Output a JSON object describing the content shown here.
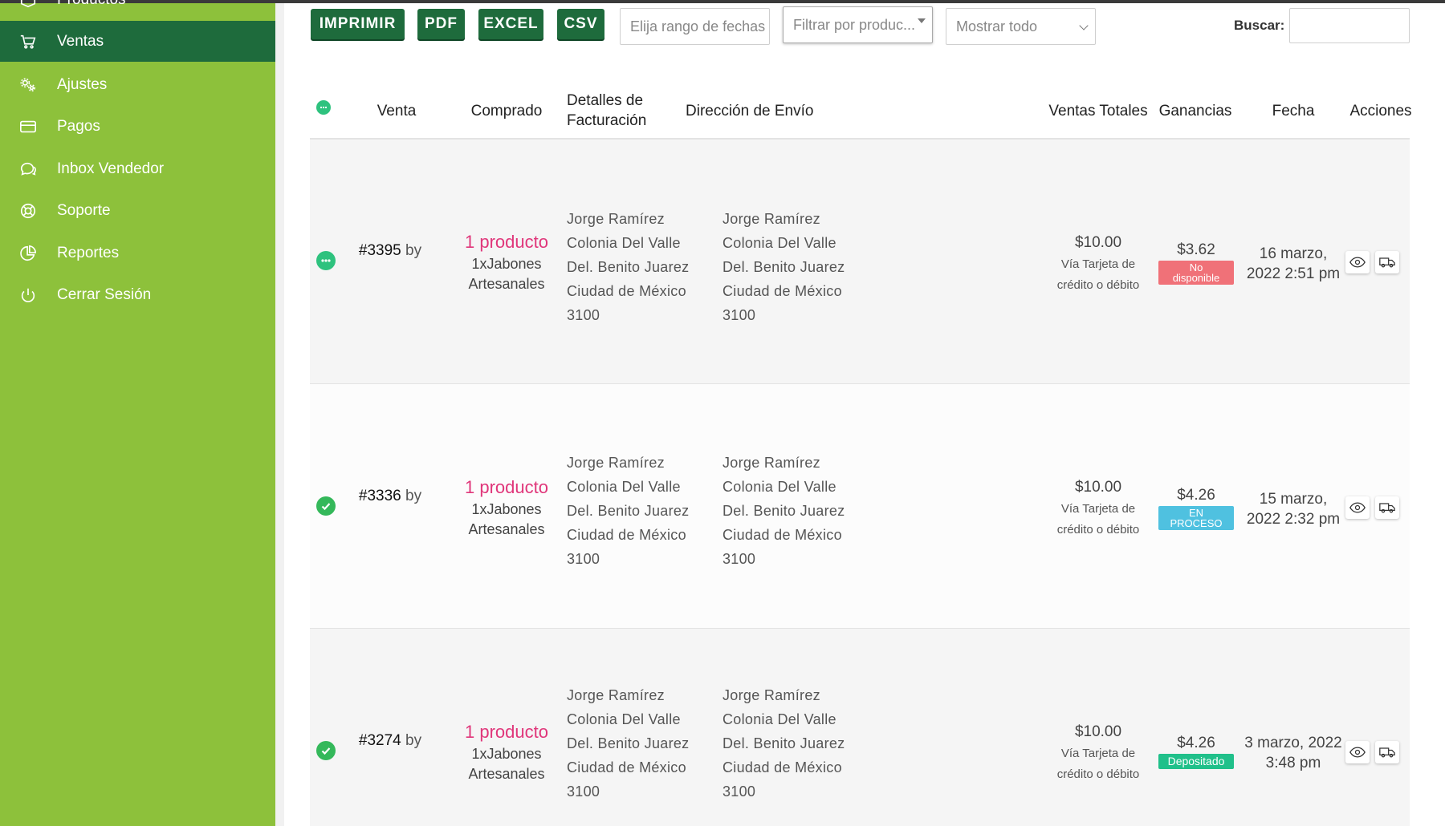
{
  "sidebar": {
    "items": [
      {
        "label": "Productos",
        "icon": "box-icon",
        "active": false
      },
      {
        "label": "Ventas",
        "icon": "cart-icon",
        "active": true
      },
      {
        "label": "Ajustes",
        "icon": "gears-icon",
        "active": false
      },
      {
        "label": "Pagos",
        "icon": "credit-card-icon",
        "active": false
      },
      {
        "label": "Inbox Vendedor",
        "icon": "chat-icon",
        "active": false
      },
      {
        "label": "Soporte",
        "icon": "lifebuoy-icon",
        "active": false
      },
      {
        "label": "Reportes",
        "icon": "pie-chart-icon",
        "active": false
      },
      {
        "label": "Cerrar Sesión",
        "icon": "power-icon",
        "active": false
      }
    ]
  },
  "toolbar": {
    "print_label": "IMPRIMIR",
    "pdf_label": "PDF",
    "excel_label": "EXCEL",
    "csv_label": "CSV",
    "date_range_placeholder": "Elija rango de fechas",
    "product_filter_placeholder": "Filtrar por produc...",
    "show_select_value": "Mostrar todo",
    "search_label": "Buscar:",
    "search_value": ""
  },
  "table": {
    "headers": {
      "venta": "Venta",
      "comprado": "Comprado",
      "billing_line1": "Detalles de",
      "billing_line2": "Facturación",
      "shipping": "Dirección de Envío",
      "total": "Ventas Totales",
      "profit": "Ganancias",
      "date": "Fecha",
      "actions": "Acciones"
    },
    "rows": [
      {
        "status": "pending",
        "order_id": "#3395",
        "by": "by",
        "product_link": "1 producto",
        "product_line1": "1xJabones",
        "product_line2": "Artesanales",
        "billing": [
          "Jorge Ramírez",
          "Colonia Del Valle",
          "Del. Benito Juarez",
          "Ciudad de México",
          "3100"
        ],
        "shipping": [
          "Jorge Ramírez",
          "Colonia Del Valle",
          "Del. Benito Juarez",
          "Ciudad de México",
          "3100"
        ],
        "total": "$10.00",
        "payment_line1": "Vía Tarjeta de",
        "payment_line2": "crédito o débito",
        "profit": "$3.62",
        "badge_line1": "No",
        "badge_line2": "disponible",
        "badge_color": "#f07178",
        "date_line1": "16 marzo,",
        "date_line2": "2022 2:51 pm"
      },
      {
        "status": "done",
        "order_id": "#3336",
        "by": "by",
        "product_link": "1 producto",
        "product_line1": "1xJabones",
        "product_line2": "Artesanales",
        "billing": [
          "Jorge Ramírez",
          "Colonia Del Valle",
          "Del. Benito Juarez",
          "Ciudad de México",
          "3100"
        ],
        "shipping": [
          "Jorge Ramírez",
          "Colonia Del Valle",
          "Del. Benito Juarez",
          "Ciudad de México",
          "3100"
        ],
        "total": "$10.00",
        "payment_line1": "Vía Tarjeta de",
        "payment_line2": "crédito o débito",
        "profit": "$4.26",
        "badge_line1": "EN",
        "badge_line2": "PROCESO",
        "badge_color": "#4fc1e0",
        "date_line1": "15 marzo,",
        "date_line2": "2022 2:32 pm"
      },
      {
        "status": "done",
        "order_id": "#3274",
        "by": "by",
        "product_link": "1 producto",
        "product_line1": "1xJabones",
        "product_line2": "Artesanales",
        "billing": [
          "Jorge Ramírez",
          "Colonia Del Valle",
          "Del. Benito Juarez",
          "Ciudad de México",
          "3100"
        ],
        "shipping": [
          "Jorge Ramírez",
          "Colonia Del Valle",
          "Del. Benito Juarez",
          "Ciudad de México",
          "3100"
        ],
        "total": "$10.00",
        "payment_line1": "Vía Tarjeta de",
        "payment_line2": "crédito o débito",
        "profit": "$4.26",
        "badge_line1": "Depositado",
        "badge_line2": "",
        "badge_color": "#20c08a",
        "date_line1": "3 marzo, 2022",
        "date_line2": "3:48 pm"
      }
    ]
  },
  "colors": {
    "sidebar_bg": "#8dc13b",
    "sidebar_active": "#1e6b3c",
    "button_bg": "#1e6b3c",
    "link_pink": "#e0367a"
  }
}
